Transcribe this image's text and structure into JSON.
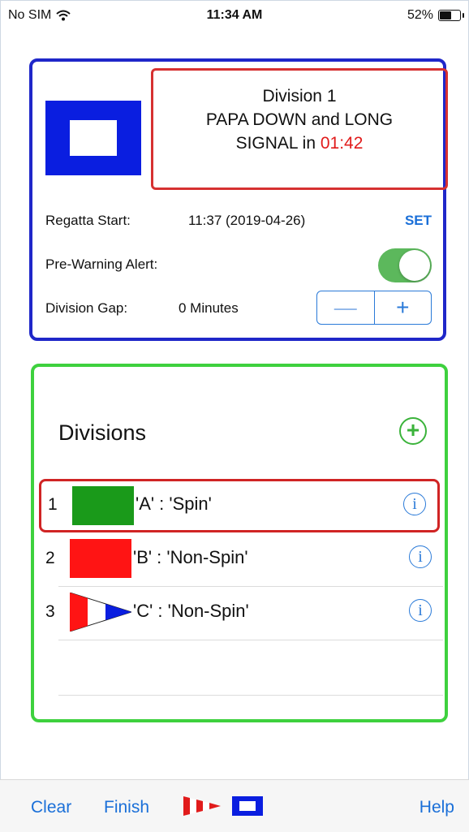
{
  "status_bar": {
    "carrier": "No SIM",
    "time": "11:34 AM",
    "battery_percent": "52%"
  },
  "signal": {
    "line1": "Division 1",
    "line2": "PAPA DOWN and LONG",
    "line3": "SIGNAL in ",
    "countdown": "01:42",
    "countdown_color": "#e11b1b"
  },
  "regatta": {
    "label": "Regatta Start:",
    "value": "11:37 (2019-04-26)",
    "set_label": "SET"
  },
  "pre_warning": {
    "label": "Pre-Warning Alert:",
    "enabled": true
  },
  "division_gap": {
    "label": "Division Gap:",
    "value": "0  Minutes",
    "minus": "—",
    "plus": "+"
  },
  "divisions": {
    "title": "Divisions",
    "add_symbol": "+",
    "items": [
      {
        "number": "1",
        "label": "'A' : 'Spin'",
        "flag_color": "#1a9a1a",
        "info": "i"
      },
      {
        "number": "2",
        "label": "'B' : 'Non-Spin'",
        "flag_color": "#ff1414",
        "info": "i"
      },
      {
        "number": "3",
        "label": "'C' : 'Non-Spin'",
        "flag_color": "pennant",
        "info": "i"
      }
    ]
  },
  "toolbar": {
    "clear": "Clear",
    "finish": "Finish",
    "help": "Help"
  },
  "colors": {
    "accent": "#1a6fd8",
    "top_panel_border": "#1f27c9",
    "divisions_border": "#3ed13e",
    "highlight": "#d63131"
  }
}
